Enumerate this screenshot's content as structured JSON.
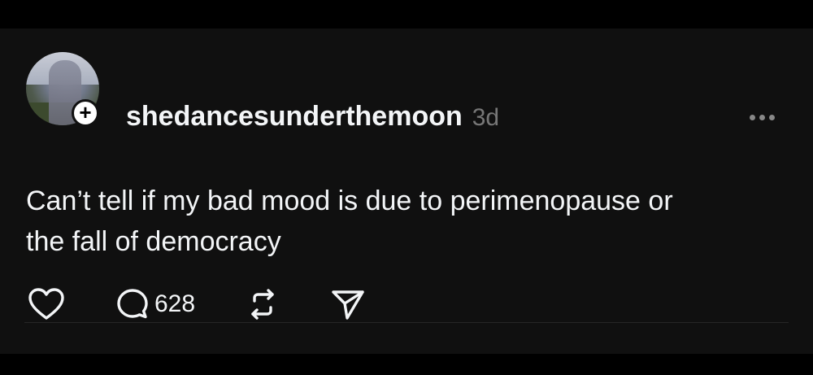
{
  "post": {
    "username": "shedancesunderthemoon",
    "timestamp": "3d",
    "text_line1": "Can’t tell if my bad mood is due to perimenopause or",
    "text_line2": "the fall of democracy",
    "follow_badge_symbol": "+",
    "more_icon": "more-horizontal-icon"
  },
  "actions": {
    "like_icon": "heart-icon",
    "reply_icon": "speech-bubble-icon",
    "reply_count": "628",
    "repost_icon": "repost-icon",
    "share_icon": "paper-plane-icon"
  },
  "colors": {
    "background": "#101010",
    "text": "#f3f5f7",
    "muted": "#777777"
  }
}
